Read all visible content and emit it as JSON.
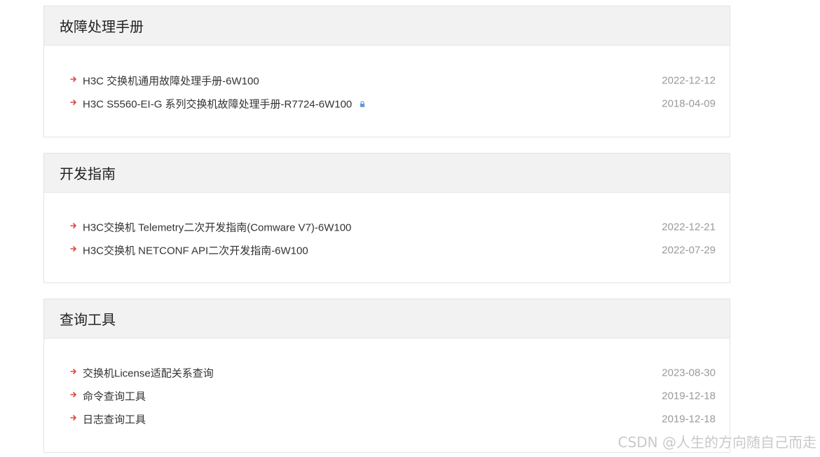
{
  "sections": [
    {
      "title": "故障处理手册",
      "items": [
        {
          "label": "H3C 交换机通用故障处理手册-6W100",
          "date": "2022-12-12",
          "locked": false
        },
        {
          "label": "H3C S5560-EI-G 系列交换机故障处理手册-R7724-6W100",
          "date": "2018-04-09",
          "locked": true
        }
      ]
    },
    {
      "title": "开发指南",
      "items": [
        {
          "label": "H3C交换机 Telemetry二次开发指南(Comware V7)-6W100",
          "date": "2022-12-21",
          "locked": false
        },
        {
          "label": "H3C交换机 NETCONF API二次开发指南-6W100",
          "date": "2022-07-29",
          "locked": false
        }
      ]
    },
    {
      "title": "查询工具",
      "items": [
        {
          "label": "交换机License适配关系查询",
          "date": "2023-08-30",
          "locked": false
        },
        {
          "label": "命令查询工具",
          "date": "2019-12-18",
          "locked": false
        },
        {
          "label": "日志查询工具",
          "date": "2019-12-18",
          "locked": false
        }
      ]
    }
  ],
  "icons": {
    "bullet": "arrow-right-icon",
    "locked": "lock-icon"
  },
  "colors": {
    "arrow": "#e0463f",
    "lock": "#5b9bd5",
    "header_bg": "#f2f2f2",
    "date": "#9a9a9a"
  },
  "watermark": "CSDN @人生的方向随自己而走"
}
